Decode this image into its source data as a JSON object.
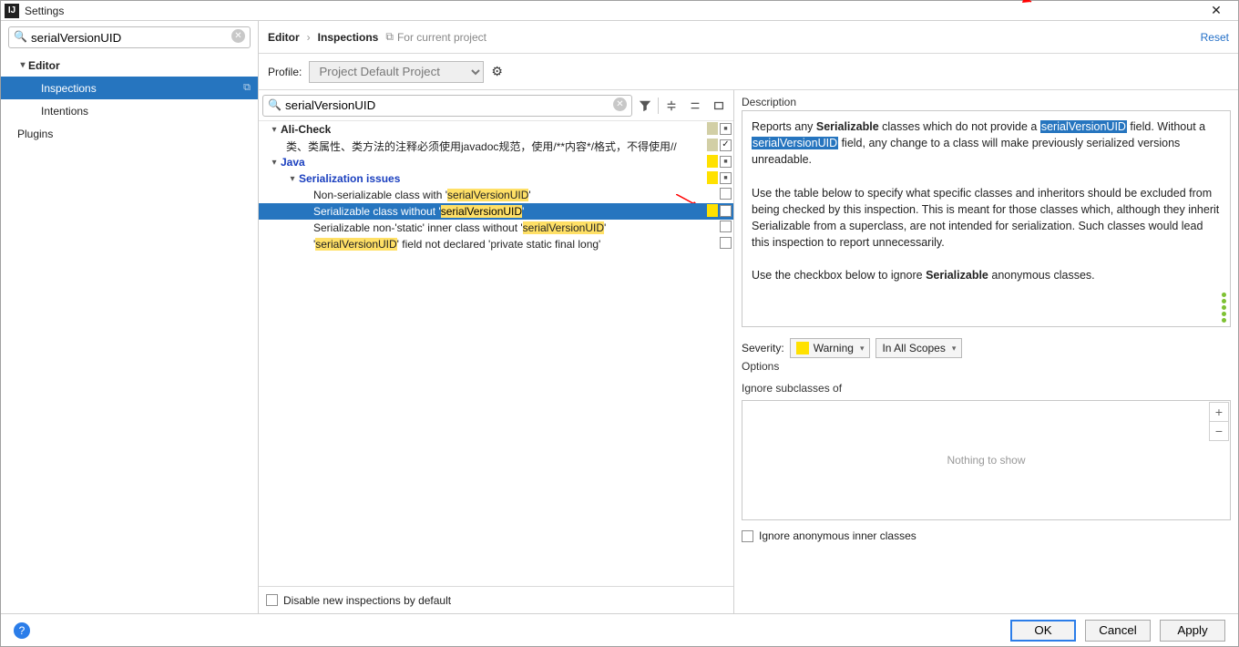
{
  "window": {
    "title": "Settings",
    "close_glyph": "✕"
  },
  "sidebar": {
    "search_value": "serialVersionUID",
    "items": [
      {
        "label": "Editor",
        "kind": "header"
      },
      {
        "label": "Inspections",
        "kind": "child",
        "selected": true
      },
      {
        "label": "Intentions",
        "kind": "child"
      },
      {
        "label": "Plugins",
        "kind": "header-plain"
      }
    ]
  },
  "breadcrumb": {
    "part1": "Editor",
    "part2": "Inspections",
    "project_hint": "For current project",
    "reset": "Reset"
  },
  "profile": {
    "label": "Profile:",
    "selected": "Project Default  Project"
  },
  "tree": {
    "search_value": "serialVersionUID",
    "rows": [
      {
        "indent": 10,
        "chev": "▾",
        "text": "Ali-Check",
        "bold": true,
        "swatches": [
          "tan"
        ],
        "cb": "mix"
      },
      {
        "indent": 30,
        "text": "类、类属性、类方法的注释必须使用javadoc规范，使用/**内容*/格式，不得使用//",
        "swatches": [
          "tan"
        ],
        "cb": "chk"
      },
      {
        "indent": 10,
        "chev": "▾",
        "text": "Java",
        "bold": true,
        "blue": true,
        "swatches": [
          "yel"
        ],
        "cb": "mix"
      },
      {
        "indent": 30,
        "chev": "▾",
        "text": "Serialization issues",
        "bold": true,
        "blue": true,
        "swatches": [
          "yel"
        ],
        "cb": "mix"
      },
      {
        "indent": 60,
        "html": "Non-serializable class with '<span class=\"hl\">serialVersionUID</span>'",
        "cb": "off"
      },
      {
        "indent": 60,
        "html": "Serializable class without '<span class=\"hl\">serialVersionUID</span>'",
        "sel": true,
        "swatches": [
          "yel"
        ],
        "cb": "chk"
      },
      {
        "indent": 60,
        "html": "Serializable non-'static' inner class without '<span class=\"hl\">serialVersionUID</span>'",
        "cb": "off"
      },
      {
        "indent": 60,
        "html": "'<span class=\"hl\">serialVersionUID</span>' field not declared 'private static final long'",
        "cb": "off"
      }
    ],
    "disable_label": "Disable new inspections by default",
    "disable_checked": false
  },
  "detail": {
    "desc_label": "Description",
    "desc_html": "Reports any <b>Serializable</b> classes which do not provide a <span class=\"term\">serialVersionUID</span> field. Without a <span class=\"term\">serialVersionUID</span> field, any change to a class will make previously serialized versions unreadable.<br><br>Use the table below to specify what specific classes and inheritors should be excluded from being checked by this inspection. This is meant for those classes which, although they inherit Serializable from a superclass, are not intended for serialization. Such classes would lead this inspection to report unnecessarily.<br><br>Use the checkbox below to ignore <b>Serializable</b> anonymous classes.",
    "severity_label": "Severity:",
    "severity_value": "Warning",
    "scope_value": "In All Scopes",
    "options_label": "Options",
    "ignore_sub_label": "Ignore subclasses of",
    "empty_list": "Nothing to show",
    "anon_label": "Ignore anonymous inner classes",
    "anon_checked": false
  },
  "footer": {
    "ok": "OK",
    "cancel": "Cancel",
    "apply": "Apply"
  }
}
